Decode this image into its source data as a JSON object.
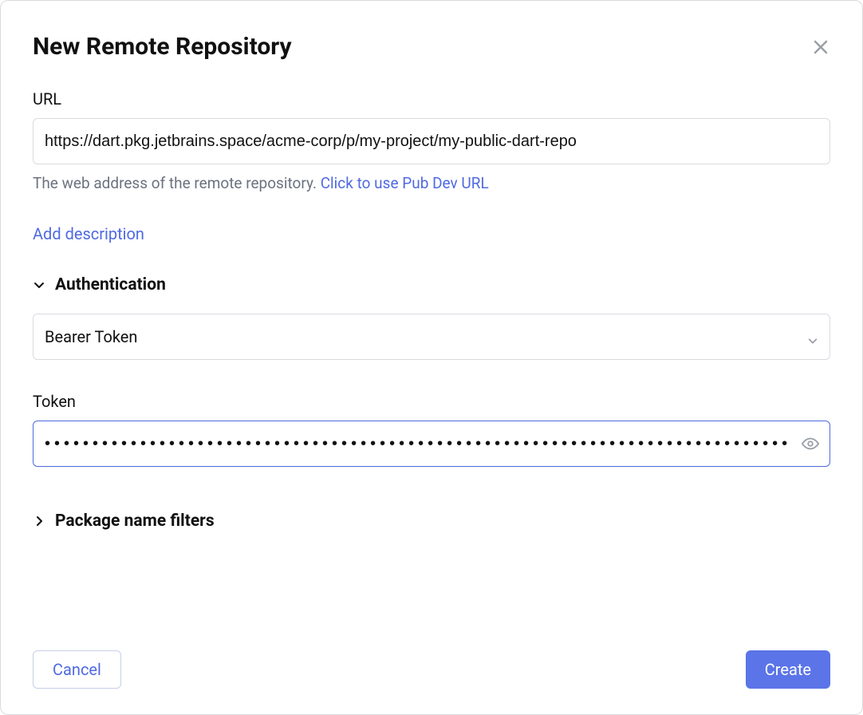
{
  "dialog": {
    "title": "New Remote Repository"
  },
  "url": {
    "label": "URL",
    "value": "https://dart.pkg.jetbrains.space/acme-corp/p/my-project/my-public-dart-repo",
    "helper_prefix": "The web address of the remote repository. ",
    "helper_link": "Click to use Pub Dev URL"
  },
  "add_description_link": "Add description",
  "auth": {
    "section_label": "Authentication",
    "type_selected": "Bearer Token",
    "token_label": "Token",
    "token_value": "••••••••••••••••••••••••••••••••••••••••••••••••••••••••••••••••••••••••••••••••••••••••••••"
  },
  "pkg_filters": {
    "section_label": "Package name filters"
  },
  "actions": {
    "cancel": "Cancel",
    "create": "Create"
  }
}
